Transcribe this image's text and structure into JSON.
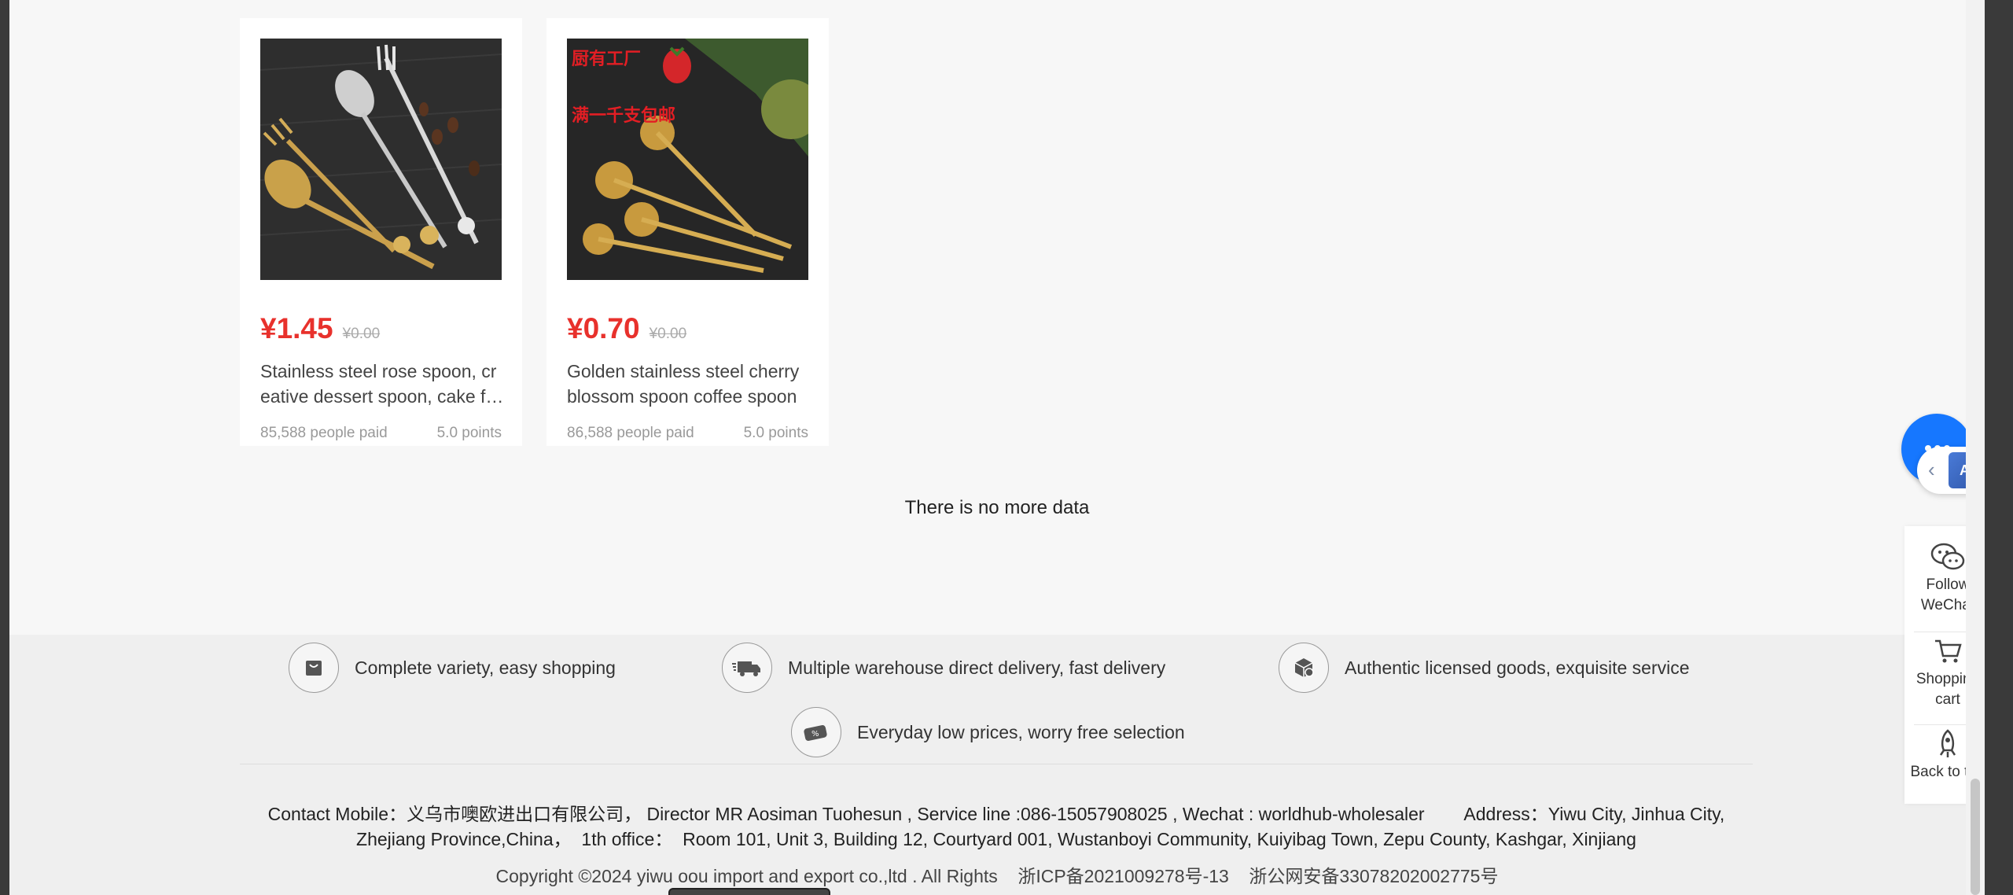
{
  "products": [
    {
      "price": "¥1.45",
      "original_price": "¥0.00",
      "title": "Stainless steel rose spoon, creative dessert spoon, cake fork",
      "paid": "85,588 people paid",
      "rating": "5.0 points"
    },
    {
      "price": "¥0.70",
      "original_price": "¥0.00",
      "title": "Golden stainless steel cherry blossom spoon coffee spoon",
      "paid": "86,588 people paid",
      "rating": "5.0 points",
      "image_overlay_lines": [
        "厨有工厂",
        "满一千支包邮"
      ]
    }
  ],
  "list_end_text": "There is no more data",
  "features": [
    {
      "icon": "shopping-bag-icon",
      "label": "Complete variety, easy shopping"
    },
    {
      "icon": "delivery-truck-icon",
      "label": "Multiple warehouse direct delivery, fast delivery"
    },
    {
      "icon": "authentic-goods-icon",
      "label": "Authentic licensed goods, exquisite service"
    },
    {
      "icon": "discount-tag-icon",
      "label": "Everyday low prices, worry free selection"
    }
  ],
  "contact": {
    "line1": "Contact Mobile：义乌市噢欧进出口有限公司， Director MR Aosiman Tuohesun , Service line :086-15057908025 , Wechat : worldhub-wholesaler        Address：Yiwu City, Jinhua City,",
    "line2": "Zhejiang Province,China，  1th office：  Room 101, Unit 3, Building 12, Courtyard 001, Wustanboyi Community, Kuiyibag Town, Zepu County, Kashgar, Xinjiang"
  },
  "copyright": "Copyright ©2024 yiwu oou import and export co.,ltd . All Rights    浙ICP备2021009278号-13    浙公网安备33078202002775号",
  "chat": {
    "ai_label": "AI"
  },
  "side_tools": [
    {
      "icon": "wechat-icon",
      "label": "Follow WeChat"
    },
    {
      "icon": "shopping-cart-icon",
      "label": "Shopping cart"
    },
    {
      "icon": "rocket-icon",
      "label": "Back to top"
    }
  ],
  "colors": {
    "price": "#e8312c",
    "chat_button": "#1677ff"
  }
}
